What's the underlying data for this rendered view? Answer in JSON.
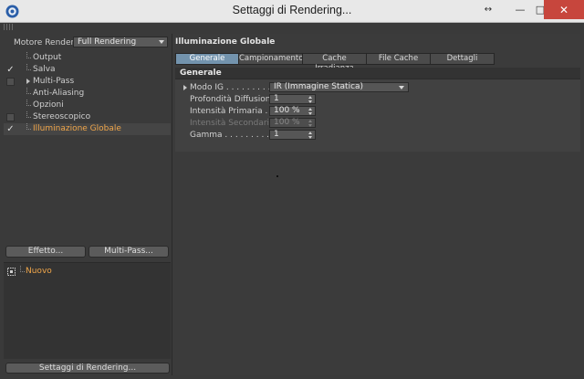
{
  "window": {
    "title": "Settaggi di Rendering...",
    "buttons": {
      "resize": "↔",
      "minimize": "—",
      "maximize": "□",
      "close": "✕"
    }
  },
  "left_panel": {
    "motore_label": "Motore Render",
    "motore_value": "Full Rendering",
    "tree": [
      {
        "label": "Output",
        "check": "none",
        "expander": false,
        "active": false
      },
      {
        "label": "Salva",
        "check": "checked",
        "expander": false,
        "active": false
      },
      {
        "label": "Multi-Pass",
        "check": "box",
        "expander": true,
        "active": false
      },
      {
        "label": "Anti-Aliasing",
        "check": "none",
        "expander": false,
        "active": false
      },
      {
        "label": "Opzioni",
        "check": "none",
        "expander": false,
        "active": false
      },
      {
        "label": "Stereoscopico",
        "check": "box",
        "expander": false,
        "active": false
      },
      {
        "label": "Illuminazione Globale",
        "check": "checked",
        "expander": false,
        "active": true
      }
    ],
    "effetto_button": "Effetto...",
    "multipass_button": "Multi-Pass...",
    "preset_label": "Nuovo",
    "settaggi_button": "Settaggi di Rendering..."
  },
  "right_panel": {
    "section_title": "Illuminazione Globale",
    "tabs": [
      {
        "label": "Generale",
        "active": true
      },
      {
        "label": "Campionamento",
        "active": false
      },
      {
        "label": "Cache Irradianza",
        "active": false
      },
      {
        "label": "File Cache",
        "active": false
      },
      {
        "label": "Dettagli",
        "active": false
      }
    ],
    "group_title": "Generale",
    "params": {
      "modo_label": "Modo IG . . . . . . . . . . .",
      "modo_value": "IR (Immagine Statica)",
      "profondita_label": "Profondità Diffusione",
      "profondita_value": "1",
      "intensita_primaria_label": "Intensità Primaria . . .",
      "intensita_primaria_value": "100 %",
      "intensita_secondaria_label": "Intensità Secondaria",
      "intensita_secondaria_value": "100 %",
      "gamma_label": "Gamma . . . . . . . . . . . .",
      "gamma_value": "1"
    }
  },
  "colors": {
    "accent_orange": "#f0a64a",
    "tab_active": "#7393ad",
    "close_red": "#c7463d"
  }
}
